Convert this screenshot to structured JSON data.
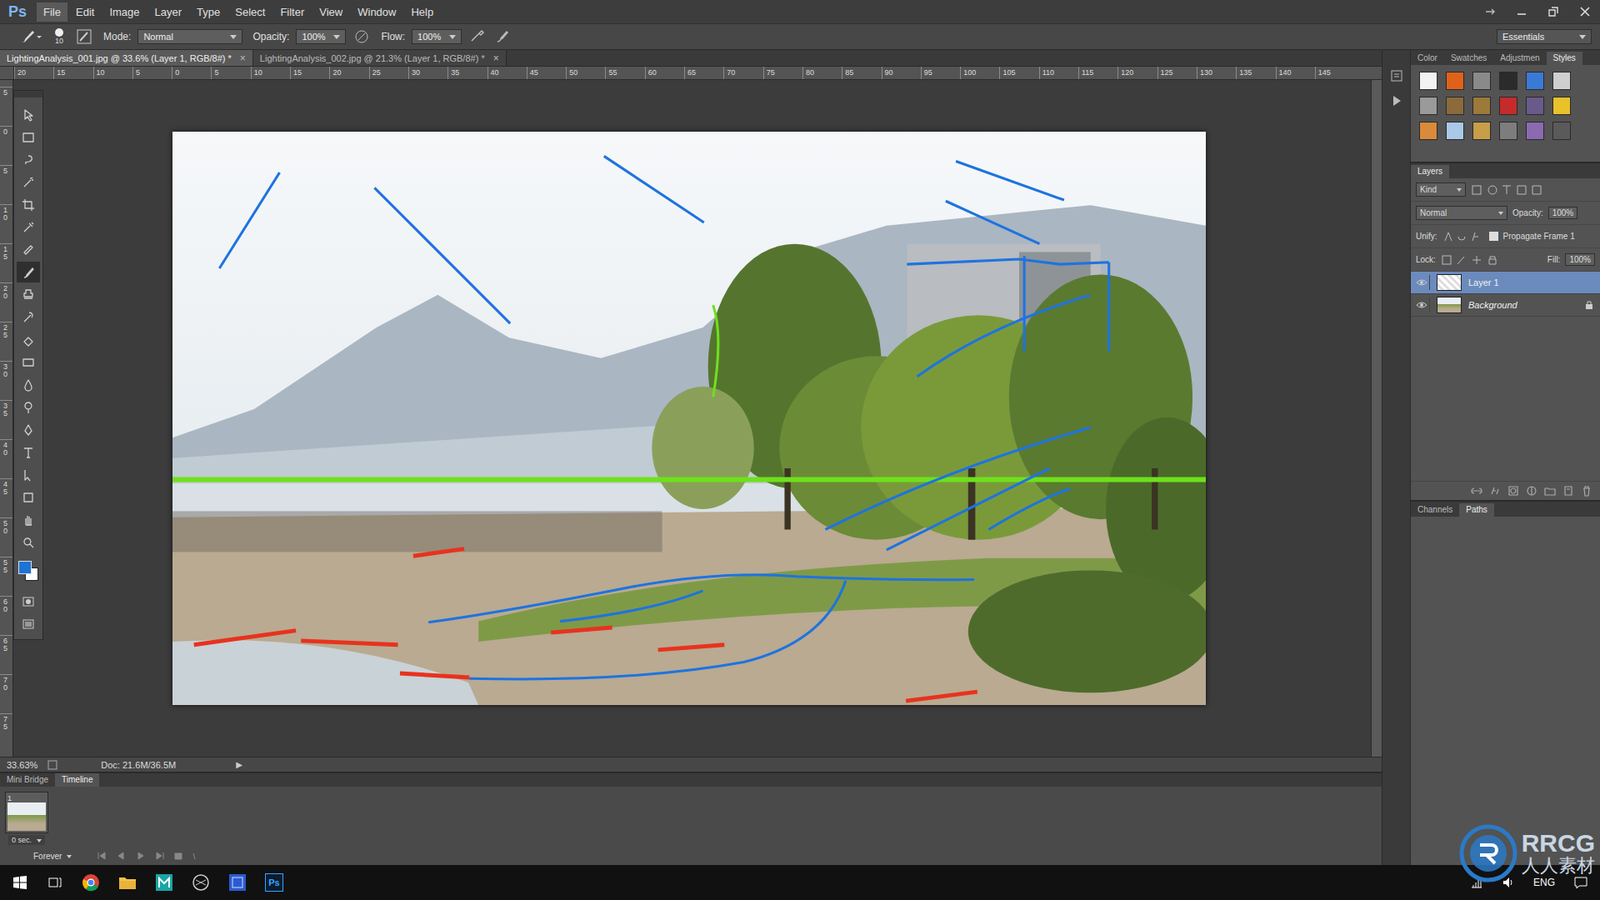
{
  "app": {
    "logo": "Ps"
  },
  "menu": [
    {
      "label": "File",
      "selected": true
    },
    {
      "label": "Edit",
      "selected": false
    },
    {
      "label": "Image",
      "selected": false
    },
    {
      "label": "Layer",
      "selected": false
    },
    {
      "label": "Type",
      "selected": false
    },
    {
      "label": "Select",
      "selected": false
    },
    {
      "label": "Filter",
      "selected": false
    },
    {
      "label": "View",
      "selected": false
    },
    {
      "label": "Window",
      "selected": false
    },
    {
      "label": "Help",
      "selected": false
    }
  ],
  "options": {
    "brush_size": "10",
    "mode_label": "Mode:",
    "mode": "Normal",
    "opacity_label": "Opacity:",
    "opacity": "100%",
    "flow_label": "Flow:",
    "flow": "100%"
  },
  "workspace": {
    "label": "Essentials"
  },
  "doc_tabs": [
    {
      "label": "LightingAnalysis_001.jpg @ 33.6% (Layer 1, RGB/8#) *",
      "close": "×",
      "selected": true
    },
    {
      "label": "LightingAnalysis_002.jpg @ 21.3% (Layer 1, RGB/8#) *",
      "close": "×",
      "selected": false
    }
  ],
  "ruler": {
    "horizontal": [
      "20",
      "15",
      "10",
      "5",
      "0",
      "5",
      "10",
      "15",
      "20",
      "25",
      "30",
      "35",
      "40",
      "45",
      "50",
      "55",
      "60",
      "65",
      "70",
      "75",
      "80",
      "85",
      "90",
      "95",
      "100",
      "105",
      "110",
      "115",
      "120",
      "125",
      "130",
      "135",
      "140",
      "145"
    ],
    "vertical": [
      "5",
      "0",
      "5",
      "10",
      "15",
      "20",
      "25",
      "30",
      "35",
      "40",
      "45",
      "50",
      "55",
      "60",
      "65",
      "70",
      "75"
    ]
  },
  "toolbox": {
    "tools": [
      {
        "selected": false
      },
      {
        "selected": false
      },
      {
        "selected": false
      },
      {
        "selected": false
      },
      {
        "selected": false
      },
      {
        "selected": false
      },
      {
        "selected": false
      },
      {
        "selected": true
      },
      {
        "selected": false
      },
      {
        "selected": false
      },
      {
        "selected": false
      },
      {
        "selected": false
      },
      {
        "selected": false
      },
      {
        "selected": false
      },
      {
        "selected": false
      },
      {
        "selected": false
      },
      {
        "selected": false
      },
      {
        "selected": false
      },
      {
        "selected": false
      },
      {
        "selected": false
      }
    ],
    "foreground": "#1f73d6",
    "background": "#ffffff"
  },
  "status": {
    "zoom": "33.63%",
    "doc": "Doc: 21.6M/36.5M",
    "arrow": "▶"
  },
  "bottom_panel": {
    "tabs": [
      {
        "label": "Mini Bridge",
        "selected": false
      },
      {
        "label": "Timeline",
        "selected": true
      }
    ],
    "frame": {
      "number": "1",
      "delay": "0 sec."
    },
    "loop": "Forever"
  },
  "styles_panel": {
    "tabs": [
      {
        "label": "Color",
        "selected": false
      },
      {
        "label": "Swatches",
        "selected": false
      },
      {
        "label": "Adjustmen",
        "selected": false
      },
      {
        "label": "Styles",
        "selected": true
      }
    ],
    "presets": [
      {
        "color": "#f2f2f2"
      },
      {
        "color": "#e0621a"
      },
      {
        "color": "#8a8a8a"
      },
      {
        "color": "#2b2b2b"
      },
      {
        "color": "#3a7ad6"
      },
      {
        "color": "#cfcfcf"
      },
      {
        "color": "#9a9a9a"
      },
      {
        "color": "#8b6a3b"
      },
      {
        "color": "#9c7a3a"
      },
      {
        "color": "#c62b2b"
      },
      {
        "color": "#6a5a8a"
      },
      {
        "color": "#e8c22a"
      },
      {
        "color": "#d98a3a"
      },
      {
        "color": "#aac8e8"
      },
      {
        "color": "#c89e48"
      },
      {
        "color": "#7d7d7d"
      },
      {
        "color": "#8b6ab0"
      },
      {
        "color": "#5a5a5a"
      }
    ]
  },
  "layers_panel": {
    "title": "Layers",
    "filter": "Kind",
    "blend": "Normal",
    "opacity_label": "Opacity:",
    "opacity": "100%",
    "unify_label": "Unify:",
    "propagate": {
      "label": "Propagate Frame 1",
      "checked": true
    },
    "lock_label": "Lock:",
    "fill_label": "Fill:",
    "fill": "100%",
    "layers": [
      {
        "name": "Layer 1",
        "selected": true,
        "visible": true,
        "locked": false,
        "kind": "transparent"
      },
      {
        "name": "Background",
        "selected": false,
        "visible": true,
        "locked": true,
        "kind": "photo"
      }
    ]
  },
  "channels_panel": {
    "tabs": [
      {
        "label": "Channels",
        "selected": false
      },
      {
        "label": "Paths",
        "selected": true
      }
    ]
  },
  "taskbar": {
    "ps_label": "Ps",
    "language": "ENG"
  },
  "watermark": {
    "logo": "RRCG",
    "sub": "人人素材"
  }
}
